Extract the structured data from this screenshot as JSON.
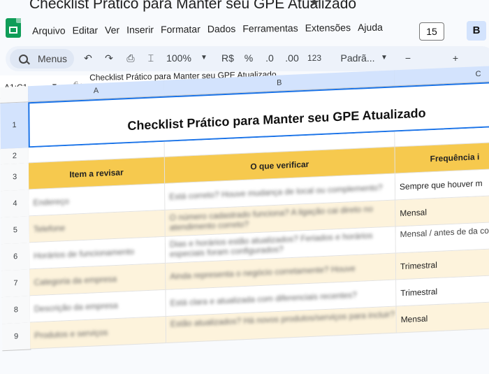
{
  "app": {
    "doc_title": "Checklist Prático para Manter seu GPE Atualizado",
    "menu": [
      "Arquivo",
      "Editar",
      "Ver",
      "Inserir",
      "Formatar",
      "Dados",
      "Ferramentas",
      "Extensões",
      "Ajuda"
    ]
  },
  "toolbar": {
    "search_label": "Menus",
    "zoom": "100%",
    "currency": "R$",
    "percent": "%",
    "dec_decrease": ".0",
    "dec_increase": ".00",
    "number_format": "123",
    "font": "Padrã...",
    "font_size": "15",
    "bold": "B"
  },
  "formula_bar": {
    "name_box": "A1:C1",
    "fx": "fx",
    "content": "Checklist Prático para Manter seu GPE Atualizado"
  },
  "sheet": {
    "columns": [
      "A",
      "B",
      "C"
    ],
    "rows": [
      "1",
      "2",
      "3",
      "4",
      "5",
      "6",
      "7",
      "8",
      "9"
    ],
    "title": "Checklist Prático para Manter seu GPE Atualizado",
    "headers": [
      "Item a revisar",
      "O que verificar",
      "Frequência i"
    ],
    "data": [
      [
        "Endereço",
        "Está correto? Houve mudança de local ou complemento?",
        "Sempre que houver m"
      ],
      [
        "Telefone",
        "O número cadastrado funciona? A ligação cai direto no atendimento correto?",
        "Mensal"
      ],
      [
        "Horários de funcionamento",
        "Dias e horários estão atualizados? Feriados e horários especiais foram configurados?",
        "Mensal / antes de da comemorativas"
      ],
      [
        "Categoria da empresa",
        "Ainda representa o negócio corretamente? Houve",
        "Trimestral"
      ],
      [
        "Descrição da empresa",
        "Está clara e atualizada com diferenciais recentes?",
        "Trimestral"
      ],
      [
        "Produtos e serviços",
        "Estão atualizados? Há novos produtos/serviços para incluir?",
        "Mensal"
      ]
    ]
  }
}
